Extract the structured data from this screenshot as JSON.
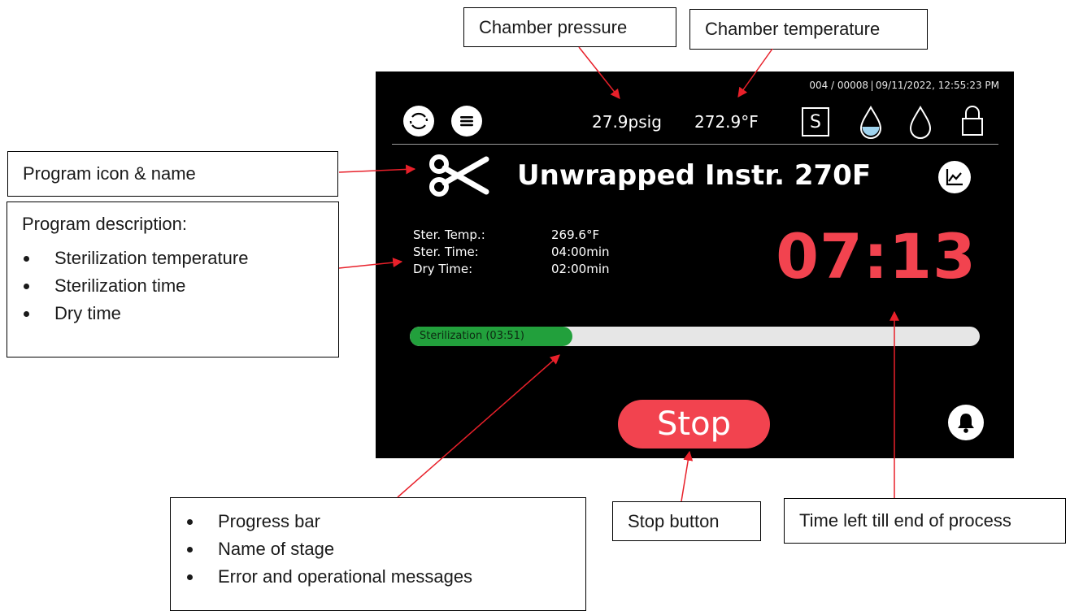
{
  "callouts": {
    "chamber_pressure": "Chamber pressure",
    "chamber_temperature": "Chamber temperature",
    "program_icon_name": "Program icon & name",
    "program_description": {
      "title": "Program description:",
      "items": [
        "Sterilization temperature",
        "Sterilization time",
        "Dry time"
      ]
    },
    "progress_info": {
      "items": [
        "Progress bar",
        "Name of stage",
        "Error and operational messages"
      ]
    },
    "stop_button": "Stop button",
    "time_left": "Time left till end of process"
  },
  "screen": {
    "header_info": "004 / 00008 | 09/11/2022, 12:55:23 PM",
    "pressure": "27.9psig",
    "temperature": "272.9°F",
    "status_letter": "S",
    "icons": {
      "refresh": "refresh-icon",
      "menu": "menu-icon",
      "water_filled": "water-drop-filled-icon",
      "water_empty": "water-drop-empty-icon",
      "lock": "lock-icon",
      "program": "scissors-icon",
      "chart": "chart-icon",
      "bell": "bell-icon"
    },
    "program_name": "Unwrapped Instr. 270F",
    "specs": [
      {
        "label": "Ster. Temp.:",
        "value": "269.6°F"
      },
      {
        "label": "Ster. Time:",
        "value": "04:00min"
      },
      {
        "label": "Dry Time:",
        "value": "02:00min"
      }
    ],
    "time_left": "07:13",
    "progress": {
      "label": "Sterilization (03:51)",
      "fraction": 0.285
    },
    "stop_label": "Stop"
  },
  "colors": {
    "screen_bg": "#000000",
    "accent_red": "#f2434f",
    "progress_green": "#22a03c",
    "progress_track": "#e6e6e6",
    "arrow": "#e8202a",
    "water_blue": "#9fd3ee"
  }
}
